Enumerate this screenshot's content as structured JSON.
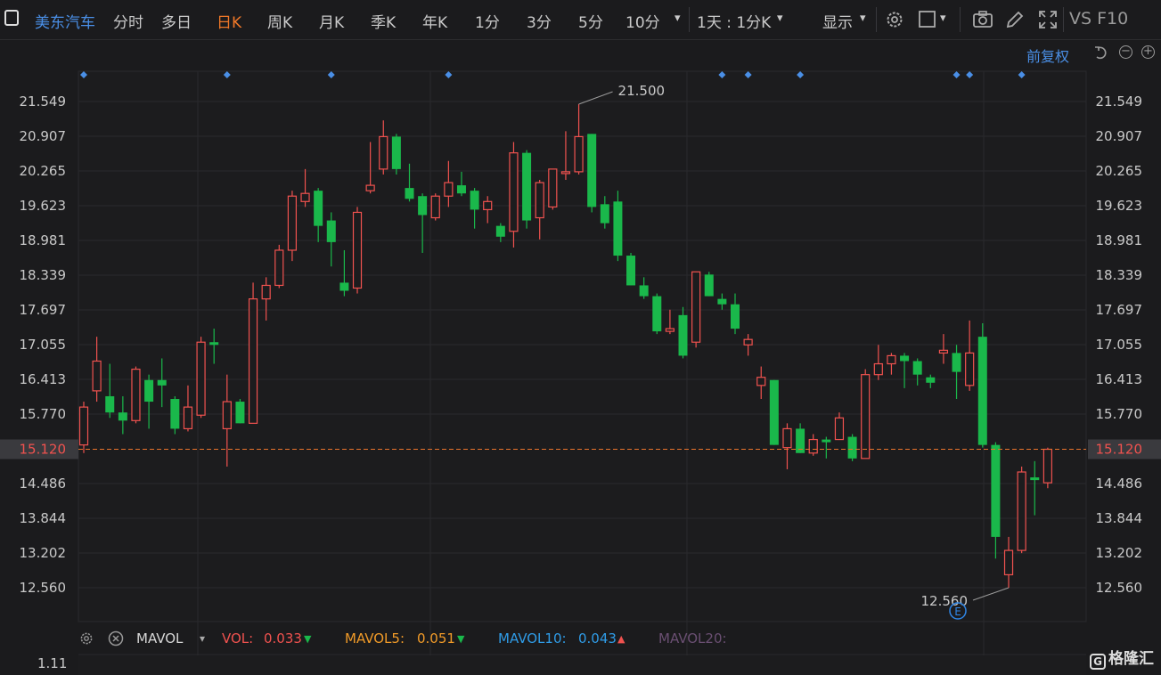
{
  "toolbar": {
    "symbol": "美东汽车",
    "items": [
      "分时",
      "多日",
      "日K",
      "周K",
      "月K",
      "季K",
      "年K",
      "1分",
      "3分",
      "5分",
      "10分"
    ],
    "active": "日K",
    "interval_select": "1天 : 1分K",
    "display": "显示",
    "brand_right": "VS F10"
  },
  "adjust_label": "前复权",
  "colors": {
    "up": "#f0524f",
    "down": "#1ab84b",
    "grid": "#2a2a2d",
    "price_line": "#e8722c",
    "axis_text": "#c9c9c9",
    "marker": "#4a8fe6"
  },
  "volume_bar": {
    "indicator": "MAVOL",
    "vol_label": "VOL:",
    "vol_value": "0.033",
    "mavol5_label": "MAVOL5:",
    "mavol5_value": "0.051",
    "mavol10_label": "MAVOL10:",
    "mavol10_value": "0.043",
    "mavol20_label": "MAVOL20:",
    "axis_top": "1.11"
  },
  "watermark": "格隆汇",
  "chart_data": {
    "type": "candlestick",
    "y_ticks": [
      "21.549",
      "20.907",
      "20.265",
      "19.623",
      "18.981",
      "18.339",
      "17.697",
      "17.055",
      "16.413",
      "15.770",
      "15.120",
      "14.486",
      "13.844",
      "13.202",
      "12.560"
    ],
    "ylim": [
      12.3,
      21.9
    ],
    "current_price": "15.120",
    "max_label": "21.500",
    "min_label": "12.560",
    "event_marker": "E",
    "markers_at_index": [
      0,
      11,
      19,
      28,
      49,
      51,
      55,
      67,
      68,
      72
    ],
    "candles": [
      {
        "o": 15.2,
        "h": 16.0,
        "l": 15.05,
        "c": 15.9
      },
      {
        "o": 16.2,
        "h": 17.2,
        "l": 16.0,
        "c": 16.75
      },
      {
        "o": 16.1,
        "h": 16.7,
        "l": 15.7,
        "c": 15.8
      },
      {
        "o": 15.8,
        "h": 16.1,
        "l": 15.4,
        "c": 15.65
      },
      {
        "o": 15.65,
        "h": 16.65,
        "l": 15.6,
        "c": 16.6
      },
      {
        "o": 16.4,
        "h": 16.5,
        "l": 15.5,
        "c": 16.0
      },
      {
        "o": 16.4,
        "h": 16.8,
        "l": 15.9,
        "c": 16.3
      },
      {
        "o": 16.05,
        "h": 16.1,
        "l": 15.4,
        "c": 15.5
      },
      {
        "o": 15.5,
        "h": 16.3,
        "l": 15.45,
        "c": 15.9
      },
      {
        "o": 15.75,
        "h": 17.2,
        "l": 15.7,
        "c": 17.1
      },
      {
        "o": 17.1,
        "h": 17.35,
        "l": 16.7,
        "c": 17.05
      },
      {
        "o": 15.5,
        "h": 16.5,
        "l": 14.8,
        "c": 16.0
      },
      {
        "o": 16.0,
        "h": 16.05,
        "l": 15.6,
        "c": 15.6
      },
      {
        "o": 15.6,
        "h": 18.2,
        "l": 15.6,
        "c": 17.9
      },
      {
        "o": 17.9,
        "h": 18.3,
        "l": 17.5,
        "c": 18.15
      },
      {
        "o": 18.15,
        "h": 18.9,
        "l": 18.1,
        "c": 18.8
      },
      {
        "o": 18.8,
        "h": 19.9,
        "l": 18.6,
        "c": 19.8
      },
      {
        "o": 19.7,
        "h": 20.3,
        "l": 19.6,
        "c": 19.85
      },
      {
        "o": 19.9,
        "h": 19.95,
        "l": 18.95,
        "c": 19.25
      },
      {
        "o": 19.35,
        "h": 19.5,
        "l": 18.5,
        "c": 18.95
      },
      {
        "o": 18.2,
        "h": 18.8,
        "l": 17.95,
        "c": 18.05
      },
      {
        "o": 18.1,
        "h": 19.6,
        "l": 18.0,
        "c": 19.5
      },
      {
        "o": 19.9,
        "h": 20.8,
        "l": 19.85,
        "c": 20.0
      },
      {
        "o": 20.3,
        "h": 21.2,
        "l": 20.2,
        "c": 20.9
      },
      {
        "o": 20.9,
        "h": 20.95,
        "l": 20.2,
        "c": 20.3
      },
      {
        "o": 19.95,
        "h": 20.4,
        "l": 19.7,
        "c": 19.75
      },
      {
        "o": 19.8,
        "h": 19.85,
        "l": 18.75,
        "c": 19.45
      },
      {
        "o": 19.4,
        "h": 19.85,
        "l": 19.35,
        "c": 19.8
      },
      {
        "o": 19.8,
        "h": 20.45,
        "l": 19.6,
        "c": 20.05
      },
      {
        "o": 20.0,
        "h": 20.25,
        "l": 19.8,
        "c": 19.85
      },
      {
        "o": 19.9,
        "h": 19.95,
        "l": 19.2,
        "c": 19.55
      },
      {
        "o": 19.55,
        "h": 19.8,
        "l": 19.3,
        "c": 19.7
      },
      {
        "o": 19.25,
        "h": 19.3,
        "l": 18.95,
        "c": 19.05
      },
      {
        "o": 19.15,
        "h": 20.8,
        "l": 18.85,
        "c": 20.6
      },
      {
        "o": 20.6,
        "h": 20.65,
        "l": 19.2,
        "c": 19.35
      },
      {
        "o": 19.4,
        "h": 20.1,
        "l": 19.0,
        "c": 20.05
      },
      {
        "o": 19.6,
        "h": 20.3,
        "l": 19.55,
        "c": 20.3
      },
      {
        "o": 20.25,
        "h": 21.0,
        "l": 20.1,
        "c": 20.25
      },
      {
        "o": 20.25,
        "h": 21.5,
        "l": 20.2,
        "c": 20.9
      },
      {
        "o": 20.95,
        "h": 20.95,
        "l": 19.5,
        "c": 19.6
      },
      {
        "o": 19.65,
        "h": 19.8,
        "l": 19.2,
        "c": 19.3
      },
      {
        "o": 19.7,
        "h": 19.9,
        "l": 18.6,
        "c": 18.7
      },
      {
        "o": 18.7,
        "h": 18.75,
        "l": 18.15,
        "c": 18.15
      },
      {
        "o": 18.15,
        "h": 18.3,
        "l": 17.9,
        "c": 17.95
      },
      {
        "o": 17.95,
        "h": 18.0,
        "l": 17.25,
        "c": 17.3
      },
      {
        "o": 17.3,
        "h": 17.7,
        "l": 17.25,
        "c": 17.35
      },
      {
        "o": 17.6,
        "h": 17.75,
        "l": 16.8,
        "c": 16.85
      },
      {
        "o": 17.1,
        "h": 18.4,
        "l": 17.0,
        "c": 18.4
      },
      {
        "o": 18.35,
        "h": 18.4,
        "l": 17.95,
        "c": 17.95
      },
      {
        "o": 17.9,
        "h": 18.0,
        "l": 17.7,
        "c": 17.8
      },
      {
        "o": 17.8,
        "h": 18.0,
        "l": 17.25,
        "c": 17.35
      },
      {
        "o": 17.05,
        "h": 17.25,
        "l": 16.85,
        "c": 17.15
      },
      {
        "o": 16.3,
        "h": 16.65,
        "l": 16.05,
        "c": 16.45
      },
      {
        "o": 16.4,
        "h": 16.4,
        "l": 15.2,
        "c": 15.2
      },
      {
        "o": 15.15,
        "h": 15.6,
        "l": 14.75,
        "c": 15.5
      },
      {
        "o": 15.5,
        "h": 15.6,
        "l": 15.05,
        "c": 15.05
      },
      {
        "o": 15.05,
        "h": 15.4,
        "l": 15.0,
        "c": 15.3
      },
      {
        "o": 15.3,
        "h": 15.35,
        "l": 14.95,
        "c": 15.25
      },
      {
        "o": 15.3,
        "h": 15.8,
        "l": 15.3,
        "c": 15.7
      },
      {
        "o": 15.35,
        "h": 15.4,
        "l": 14.9,
        "c": 14.95
      },
      {
        "o": 14.95,
        "h": 16.6,
        "l": 14.95,
        "c": 16.5
      },
      {
        "o": 16.5,
        "h": 17.05,
        "l": 16.4,
        "c": 16.7
      },
      {
        "o": 16.7,
        "h": 16.9,
        "l": 16.5,
        "c": 16.85
      },
      {
        "o": 16.85,
        "h": 16.9,
        "l": 16.25,
        "c": 16.75
      },
      {
        "o": 16.75,
        "h": 16.8,
        "l": 16.3,
        "c": 16.5
      },
      {
        "o": 16.45,
        "h": 16.5,
        "l": 16.25,
        "c": 16.35
      },
      {
        "o": 16.9,
        "h": 17.25,
        "l": 16.7,
        "c": 16.95
      },
      {
        "o": 16.9,
        "h": 17.05,
        "l": 16.05,
        "c": 16.55
      },
      {
        "o": 16.3,
        "h": 17.5,
        "l": 16.2,
        "c": 16.9
      },
      {
        "o": 17.2,
        "h": 17.45,
        "l": 15.15,
        "c": 15.2
      },
      {
        "o": 15.2,
        "h": 15.25,
        "l": 13.1,
        "c": 13.5
      },
      {
        "o": 12.8,
        "h": 13.5,
        "l": 12.56,
        "c": 13.25
      },
      {
        "o": 13.25,
        "h": 14.8,
        "l": 13.2,
        "c": 14.7
      },
      {
        "o": 14.6,
        "h": 14.9,
        "l": 13.9,
        "c": 14.55
      },
      {
        "o": 14.5,
        "h": 15.15,
        "l": 14.4,
        "c": 15.12
      }
    ]
  }
}
